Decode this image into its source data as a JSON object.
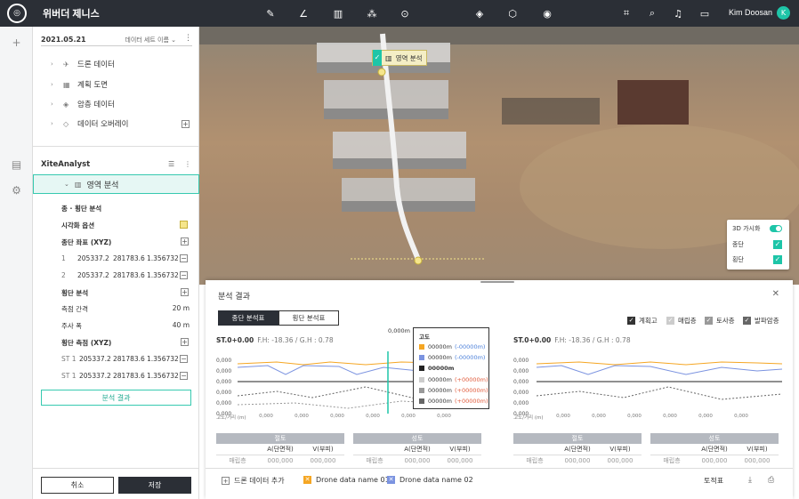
{
  "app": {
    "title": "위버더 제니스",
    "user": "Kim Doosan",
    "avatar_letter": "K"
  },
  "panel": {
    "date": "2021.05.21",
    "dataset_selector": "데이터 세트 이름",
    "tree": [
      "드론 데이터",
      "계획 도면",
      "암층 데이터",
      "데이터 오버레이"
    ],
    "xite_title": "XiteAnalyst",
    "selected_item": "영역 분석",
    "section_cross": "종 · 횡단 분석",
    "visual_option": "시각화 옵션",
    "long_coord_header": "종단 좌표 (XYZ)",
    "long_coords": [
      {
        "n": "1",
        "x": "205337.2",
        "y": "281783.6",
        "z": "1.356732"
      },
      {
        "n": "2",
        "x": "205337.2",
        "y": "281783.6",
        "z": "1.356732"
      }
    ],
    "cross_header": "횡단 분석",
    "interval_label": "측점 간격",
    "interval_value": "20 m",
    "width_label": "주사 폭",
    "width_value": "40 m",
    "cross_measure_header": "횡단 측점 (XYZ)",
    "cross_coords": [
      {
        "n": "ST 1",
        "x": "205337.2",
        "y": "281783.6",
        "z": "1.356732"
      },
      {
        "n": "ST 1",
        "x": "205337.2",
        "y": "281783.6",
        "z": "1.356732"
      }
    ],
    "result_button": "분석 결과",
    "cancel": "취소",
    "save": "저장"
  },
  "map": {
    "tooltip": "영역 분석",
    "vis_box": {
      "title": "3D 가시화",
      "row1": "종단",
      "row2": "횡단"
    }
  },
  "result": {
    "title": "분석 결과",
    "tab_long": "종단 분석표",
    "tab_cross": "횡단 분석표",
    "legend": [
      "계획고",
      "매립층",
      "토사층",
      "발파암층"
    ],
    "left_station": "ST.0+0.00",
    "left_fh": "F.H: -18.36 / G.H : 0.78",
    "right_station": "ST.0+0.00",
    "right_fh": "F.H: -18.36 / G.H : 0.78",
    "y_ticks": [
      "0,000",
      "0,000",
      "0,000",
      "0,000",
      "0,000",
      "0,000"
    ],
    "x_ticks": [
      "0,000",
      "0,000",
      "0,000",
      "0,000",
      "0,000",
      "0,000",
      "0,000"
    ],
    "x_unit": "고도/거리 (m)",
    "cursor_label": "0,000m",
    "popup": {
      "title": "고도",
      "rows": [
        {
          "value": "00000m",
          "delta": "(-00000m)",
          "color": "#f5a623"
        },
        {
          "value": "00000m",
          "delta": "(-00000m)",
          "color": "#7b93e0"
        },
        {
          "value": "00000m",
          "delta": "",
          "color": "#222222"
        },
        {
          "value": "00000m",
          "delta": "(+00000m)",
          "color": "#cccccc"
        },
        {
          "value": "00000m",
          "delta": "(+00000m)",
          "color": "#999999"
        },
        {
          "value": "00000m",
          "delta": "(+00000m)",
          "color": "#666666"
        }
      ]
    },
    "tables": {
      "cut": "절토",
      "fill": "성토",
      "area": "A(단면적)",
      "vol": "V(부피)",
      "row_label": "매립층",
      "cell": "000,000"
    },
    "bottom": {
      "add_drone": "드론 데이터 추가",
      "drone1": "Drone data name 01",
      "drone2": "Drone data name 02",
      "earthwork": "토적표"
    }
  }
}
